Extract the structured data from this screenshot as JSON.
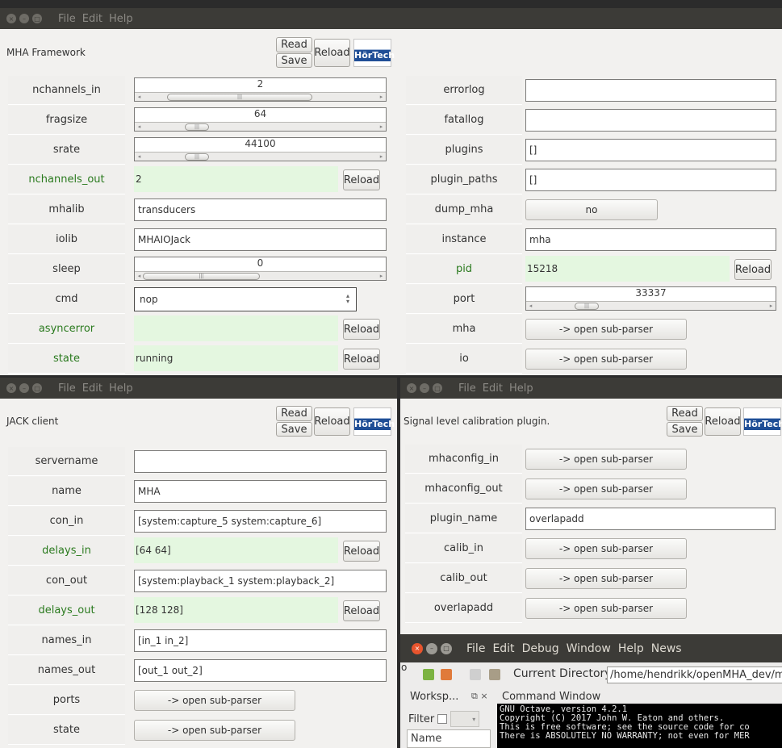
{
  "menus": [
    "File",
    "Edit",
    "Help"
  ],
  "octave_menus": [
    "File",
    "Edit",
    "Debug",
    "Window",
    "Help",
    "News"
  ],
  "buttons": {
    "read": "Read",
    "save": "Save",
    "reload": "Reload",
    "subparser": "-> open sub-parser",
    "no": "no"
  },
  "logo_text": "HörTech",
  "main": {
    "title": "MHA Framework",
    "left": [
      {
        "label": "nchannels_in",
        "kind": "slider",
        "value": "2"
      },
      {
        "label": "fragsize",
        "kind": "slider",
        "value": "64"
      },
      {
        "label": "srate",
        "kind": "slider",
        "value": "44100"
      },
      {
        "label": "nchannels_out",
        "kind": "readonly",
        "value": "2"
      },
      {
        "label": "mhalib",
        "kind": "text",
        "value": "transducers"
      },
      {
        "label": "iolib",
        "kind": "text",
        "value": "MHAIOJack"
      },
      {
        "label": "sleep",
        "kind": "slider",
        "value": "0"
      },
      {
        "label": "cmd",
        "kind": "select",
        "value": "nop"
      },
      {
        "label": "asyncerror",
        "kind": "readonly",
        "value": ""
      },
      {
        "label": "state",
        "kind": "readonly",
        "value": "running"
      }
    ],
    "right": [
      {
        "label": "errorlog",
        "kind": "text",
        "value": ""
      },
      {
        "label": "fatallog",
        "kind": "text",
        "value": ""
      },
      {
        "label": "plugins",
        "kind": "text",
        "value": "[]"
      },
      {
        "label": "plugin_paths",
        "kind": "text",
        "value": "[]"
      },
      {
        "label": "dump_mha",
        "kind": "toggle",
        "value": "no"
      },
      {
        "label": "instance",
        "kind": "text",
        "value": "mha"
      },
      {
        "label": "pid",
        "kind": "readonly",
        "value": "15218"
      },
      {
        "label": "port",
        "kind": "slider",
        "value": "33337"
      },
      {
        "label": "mha",
        "kind": "sub",
        "value": ""
      },
      {
        "label": "io",
        "kind": "sub",
        "value": ""
      }
    ]
  },
  "jack": {
    "title": "JACK client",
    "rows": [
      {
        "label": "servername",
        "kind": "text",
        "value": ""
      },
      {
        "label": "name",
        "kind": "text",
        "value": "MHA"
      },
      {
        "label": "con_in",
        "kind": "text",
        "value": "[system:capture_5 system:capture_6]"
      },
      {
        "label": "delays_in",
        "kind": "readonly",
        "value": "[64 64]"
      },
      {
        "label": "con_out",
        "kind": "text",
        "value": "[system:playback_1 system:playback_2]"
      },
      {
        "label": "delays_out",
        "kind": "readonly",
        "value": "[128 128]"
      },
      {
        "label": "names_in",
        "kind": "text",
        "value": "[in_1 in_2]"
      },
      {
        "label": "names_out",
        "kind": "text",
        "value": "[out_1 out_2]"
      },
      {
        "label": "ports",
        "kind": "sub",
        "value": ""
      },
      {
        "label": "state",
        "kind": "sub",
        "value": ""
      }
    ]
  },
  "calib": {
    "title": "Signal level calibration plugin.",
    "rows": [
      {
        "label": "mhaconfig_in",
        "kind": "sub",
        "value": ""
      },
      {
        "label": "mhaconfig_out",
        "kind": "sub",
        "value": ""
      },
      {
        "label": "plugin_name",
        "kind": "text",
        "value": "overlapadd"
      },
      {
        "label": "calib_in",
        "kind": "sub",
        "value": ""
      },
      {
        "label": "calib_out",
        "kind": "sub",
        "value": ""
      },
      {
        "label": "overlapadd",
        "kind": "sub",
        "value": ""
      }
    ]
  },
  "octave": {
    "dir_label": "Current Directory:",
    "dir_value": "/home/hendrikk/openMHA_dev/m",
    "workspace": "Worksp...",
    "command_window": "Command Window",
    "filter": "Filter",
    "name_col": "Name",
    "term": [
      "GNU Octave, version 4.2.1",
      "Copyright (C) 2017 John W. Eaton and others.",
      "This is free software; see the source code for co",
      "There is ABSOLUTELY NO WARRANTY; not even for MER"
    ]
  },
  "left_edge_char": "o"
}
